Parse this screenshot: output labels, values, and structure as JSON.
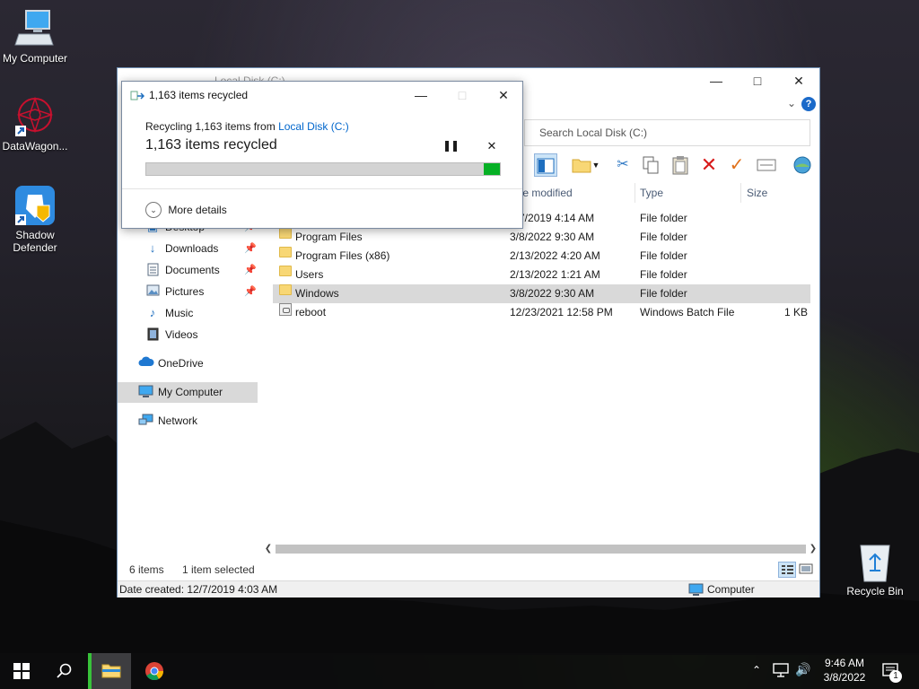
{
  "desktop": {
    "icons": [
      {
        "label": "My Computer",
        "icon": "monitor-icon"
      },
      {
        "label": "DataWagon...",
        "icon": "datawagon-icon"
      },
      {
        "label": "Shadow Defender",
        "icon": "shadow-defender-icon"
      },
      {
        "label": "Recycle Bin",
        "icon": "recycle-bin-icon"
      }
    ]
  },
  "explorer": {
    "title": "Local Disk (C:)",
    "search_placeholder": "Search Local Disk (C:)",
    "columns": [
      "te modified",
      "Type",
      "Size"
    ],
    "files": [
      {
        "name": "",
        "date": "7/7/2019 4:14 AM",
        "type": "File folder",
        "size": "",
        "icon": "folder-icon"
      },
      {
        "name": "Program Files",
        "date": "3/8/2022 9:30 AM",
        "type": "File folder",
        "size": "",
        "icon": "folder-icon"
      },
      {
        "name": "Program Files (x86)",
        "date": "2/13/2022 4:20 AM",
        "type": "File folder",
        "size": "",
        "icon": "folder-icon"
      },
      {
        "name": "Users",
        "date": "2/13/2022 1:21 AM",
        "type": "File folder",
        "size": "",
        "icon": "folder-icon"
      },
      {
        "name": "Windows",
        "date": "3/8/2022 9:30 AM",
        "type": "File folder",
        "size": "",
        "icon": "folder-icon"
      },
      {
        "name": "reboot",
        "date": "12/23/2021 12:58 PM",
        "type": "Windows Batch File",
        "size": "1 KB",
        "icon": "batch-file-icon"
      }
    ],
    "nav": [
      {
        "label": "Desktop",
        "icon": "desktop-icon",
        "pinned": true
      },
      {
        "label": "Downloads",
        "icon": "download-icon",
        "pinned": true
      },
      {
        "label": "Documents",
        "icon": "documents-icon",
        "pinned": true
      },
      {
        "label": "Pictures",
        "icon": "pictures-icon",
        "pinned": true
      },
      {
        "label": "Music",
        "icon": "music-icon",
        "pinned": false
      },
      {
        "label": "Videos",
        "icon": "videos-icon",
        "pinned": false
      },
      {
        "label": "OneDrive",
        "icon": "onedrive-icon",
        "pinned": false
      },
      {
        "label": "My Computer",
        "icon": "monitor-icon",
        "pinned": false
      },
      {
        "label": "Network",
        "icon": "network-icon",
        "pinned": false
      }
    ],
    "status": {
      "item_count": "6 items",
      "selection": "1 item selected"
    },
    "details": {
      "date_created": "Date created: 12/7/2019 4:03 AM",
      "location": "Computer"
    }
  },
  "dialog": {
    "title": "1,163 items recycled",
    "source_prefix": "Recycling 1,163 items from ",
    "source_link": "Local Disk (C:)",
    "heading": "1,163 items recycled",
    "progress": 1.0,
    "more_details": "More details"
  },
  "taskbar": {
    "time": "9:46 AM",
    "date": "3/8/2022",
    "notification_count": "1"
  },
  "colors": {
    "accent": "#0063b1",
    "progress_green": "#06b025",
    "selection_gray": "#d9d9d9",
    "link_blue": "#0066cc"
  }
}
